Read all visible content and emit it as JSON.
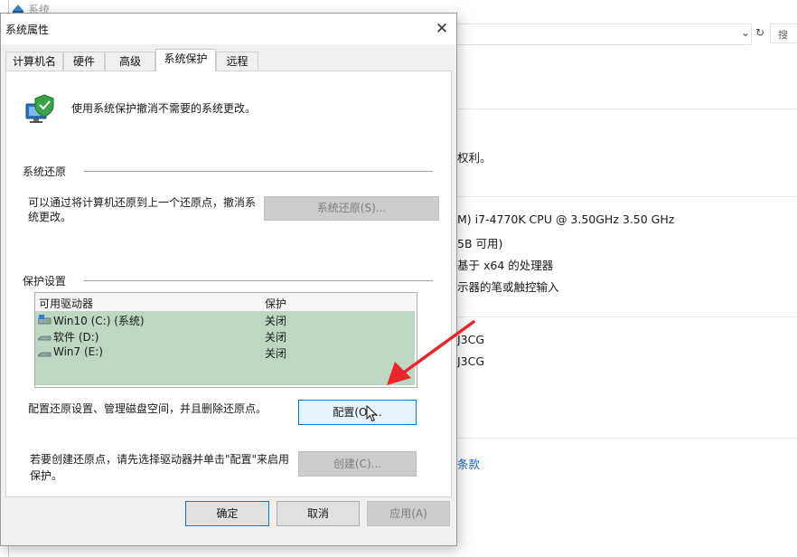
{
  "background_window": {
    "title": "系统",
    "search_label": "搜",
    "lines": [
      "权利。",
      "M) i7-4770K CPU @ 3.50GHz   3.50 GHz",
      "5B 可用)",
      "基于 x64 的处理器",
      "示器的笔或触控输入",
      "J3CG",
      "J3CG"
    ],
    "link_text": "条款"
  },
  "dialog": {
    "title": "系统属性",
    "close_glyph": "✕",
    "tabs": [
      "计算机名",
      "硬件",
      "高级",
      "系统保护",
      "远程"
    ],
    "active_tab": "系统保护",
    "intro": "使用系统保护撤消不需要的系统更改。",
    "restore_group": {
      "title": "系统还原",
      "description": "可以通过将计算机还原到上一个还原点，撤消系统更改。",
      "button": "系统还原(S)..."
    },
    "protection_group": {
      "title": "保护设置",
      "columns": [
        "可用驱动器",
        "保护"
      ],
      "drives": [
        {
          "name": "Win10 (C:) (系统)",
          "protection": "关闭",
          "icon": "system-drive-icon"
        },
        {
          "name": "软件 (D:)",
          "protection": "关闭",
          "icon": "drive-icon"
        },
        {
          "name": "Win7 (E:)",
          "protection": "关闭",
          "icon": "drive-icon"
        }
      ],
      "config_description": "配置还原设置、管理磁盘空间，并且删除还原点。",
      "config_button": "配置(O)...",
      "create_description": "若要创建还原点，请先选择驱动器并单击\"配置\"来启用保护。",
      "create_button": "创建(C)..."
    },
    "footer": {
      "ok": "确定",
      "cancel": "取消",
      "apply": "应用(A)"
    }
  },
  "colors": {
    "selection_green": "#bdd7c2",
    "focus_blue": "#0078d7",
    "annotation_arrow": "#e8262b"
  }
}
